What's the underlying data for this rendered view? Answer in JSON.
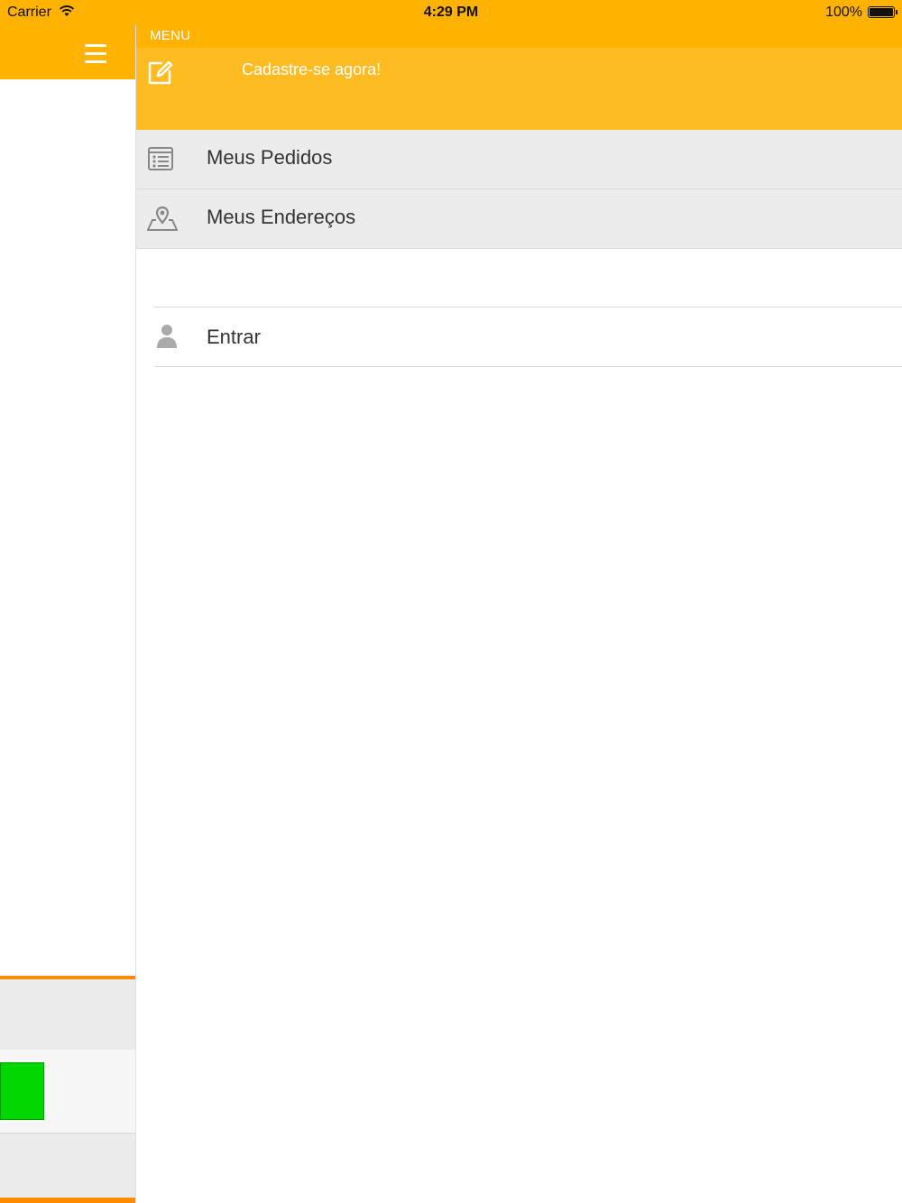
{
  "status_bar": {
    "carrier": "Carrier",
    "time": "4:29 PM",
    "battery": "100%"
  },
  "menu": {
    "title": "MENU",
    "register_label": "Cadastre-se agora!",
    "items": [
      {
        "label": "Meus Pedidos",
        "icon": "order-list-icon"
      },
      {
        "label": "Meus Endereços",
        "icon": "map-pin-icon"
      }
    ],
    "login": {
      "label": "Entrar",
      "icon": "user-icon"
    }
  },
  "colors": {
    "brand_yellow": "#ffb300",
    "header_yellow": "#ffbb22",
    "accent_orange": "#ff8c00",
    "green": "#00d800"
  }
}
